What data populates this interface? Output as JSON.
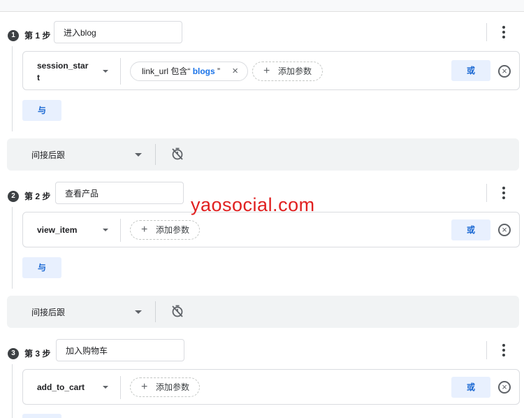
{
  "steps": [
    {
      "number": "1",
      "label": "第 1 步",
      "name": "进入blog",
      "event": {
        "name_line1": "session_star",
        "name_line2": "t"
      },
      "filters": [
        {
          "param": "link_url 包含“ ",
          "value": "blogs",
          "suffix": " ”",
          "remove": "×"
        }
      ],
      "add_param": "添加参数",
      "or_label": "或",
      "and_label": "与"
    },
    {
      "number": "2",
      "label": "第 2 步",
      "name": "查看产品",
      "event": {
        "name_line1": "view_item",
        "name_line2": ""
      },
      "filters": [],
      "add_param": "添加参数",
      "or_label": "或",
      "and_label": "与"
    },
    {
      "number": "3",
      "label": "第 3 步",
      "name": "加入购物车",
      "event": {
        "name_line1": "add_to_cart",
        "name_line2": ""
      },
      "filters": [],
      "add_param": "添加参数",
      "or_label": "或",
      "and_label": ""
    }
  ],
  "connectors": [
    {
      "label": "间接后跟",
      "icon": "timer-off-icon"
    },
    {
      "label": "间接后跟",
      "icon": "timer-off-icon"
    }
  ],
  "icons": {
    "more": "more-vert-icon",
    "remove": "cancel-circle-icon",
    "add": "plus-icon",
    "dropdown": "chevron-down-icon"
  },
  "colors": {
    "accent": "#1a73e8",
    "button_bg": "#e8f0fe",
    "watermark": "#e02020"
  },
  "watermark": "yaosocial.com"
}
